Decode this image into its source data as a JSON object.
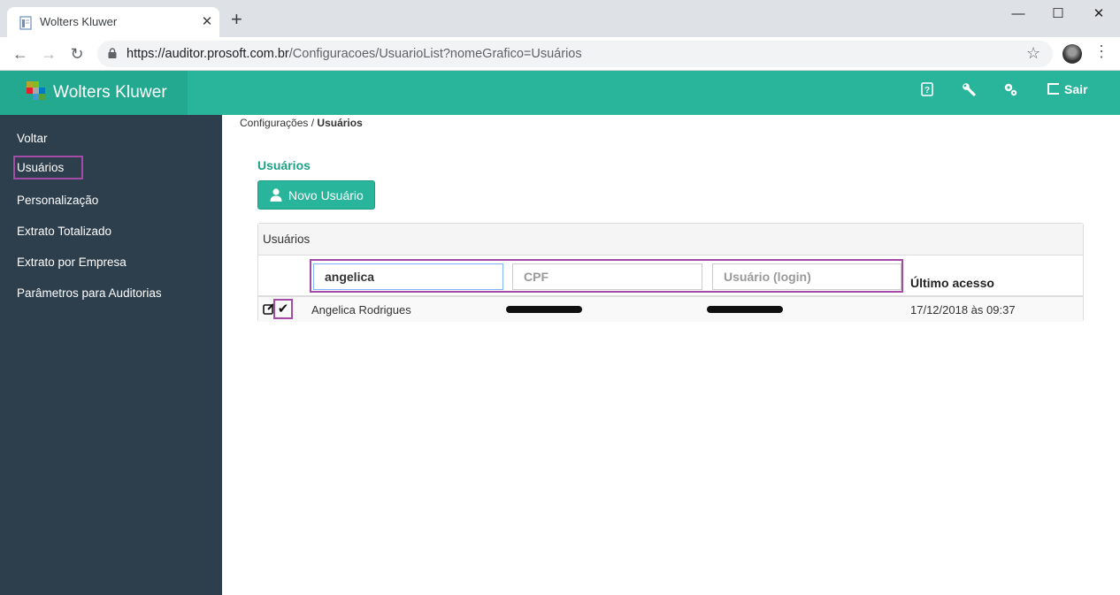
{
  "browser": {
    "tab_title": "Wolters Kluwer",
    "tab_close": "✕",
    "new_tab": "+",
    "window_controls": {
      "minimize": "—",
      "maximize": "☐",
      "close": "✕"
    },
    "nav": {
      "back": "←",
      "forward": "→",
      "reload": "↻"
    },
    "url_host": "https://auditor.prosoft.com.br",
    "url_path": "/Configuracoes/UsuarioList?nomeGrafico=Usuários",
    "bookmark": "☆",
    "menu": "⋮"
  },
  "header": {
    "brand": "Wolters Kluwer",
    "icons": [
      "help-icon",
      "wrench-icon",
      "gear-icon"
    ],
    "logout_label": "Sair",
    "colors": {
      "bar": "#29b59b",
      "brand_bg": "#22a98f"
    }
  },
  "sidebar": {
    "items": [
      {
        "label": "Voltar"
      },
      {
        "label": "Usuários"
      },
      {
        "label": "Personalização"
      },
      {
        "label": "Extrato Totalizado"
      },
      {
        "label": "Extrato por Empresa"
      },
      {
        "label": "Parâmetros para Auditorias"
      }
    ],
    "active_index": 1,
    "colors": {
      "bg": "#2d3e4c",
      "highlight": "#a44aa7"
    }
  },
  "breadcrumb": {
    "parent": "Configurações",
    "separator": " / ",
    "current": "Usuários"
  },
  "page": {
    "title": "Usuários",
    "new_user_button": "Novo Usuário"
  },
  "panel": {
    "title": "Usuários",
    "filters": {
      "name_value": "angelica",
      "cpf_placeholder": "CPF",
      "login_placeholder": "Usuário (login)"
    },
    "last_access_header": "Último acesso",
    "rows": [
      {
        "name": "Angelica Rodrigues",
        "last_access": "17/12/2018 às 09:37",
        "check": "✔"
      }
    ]
  }
}
